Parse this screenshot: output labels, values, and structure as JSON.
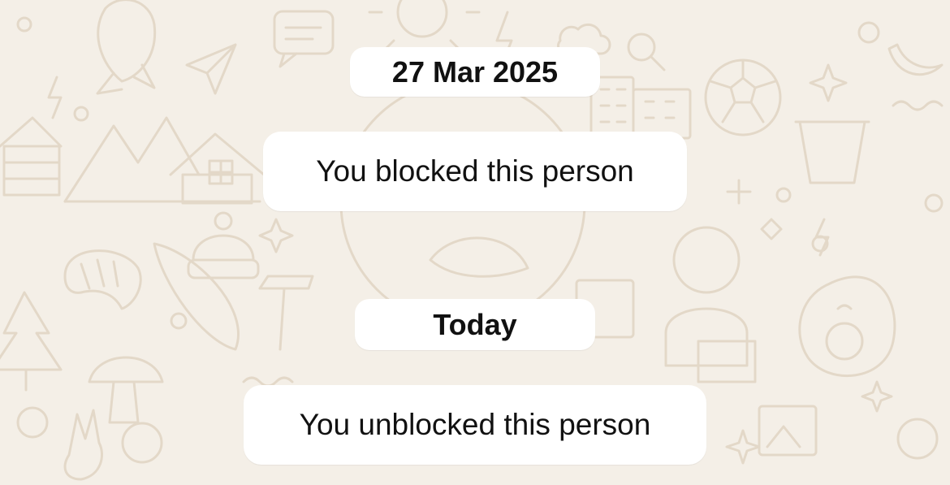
{
  "chat": {
    "wallpaper_color": "#f4efe7",
    "doodle_color": "#e3d8c8",
    "bubble_color": "#ffffff",
    "messages": [
      {
        "type": "date",
        "text": "27 Mar 2025"
      },
      {
        "type": "system",
        "text": "You blocked this person"
      },
      {
        "type": "date",
        "text": "Today"
      },
      {
        "type": "system",
        "text": "You unblocked this person"
      }
    ]
  }
}
